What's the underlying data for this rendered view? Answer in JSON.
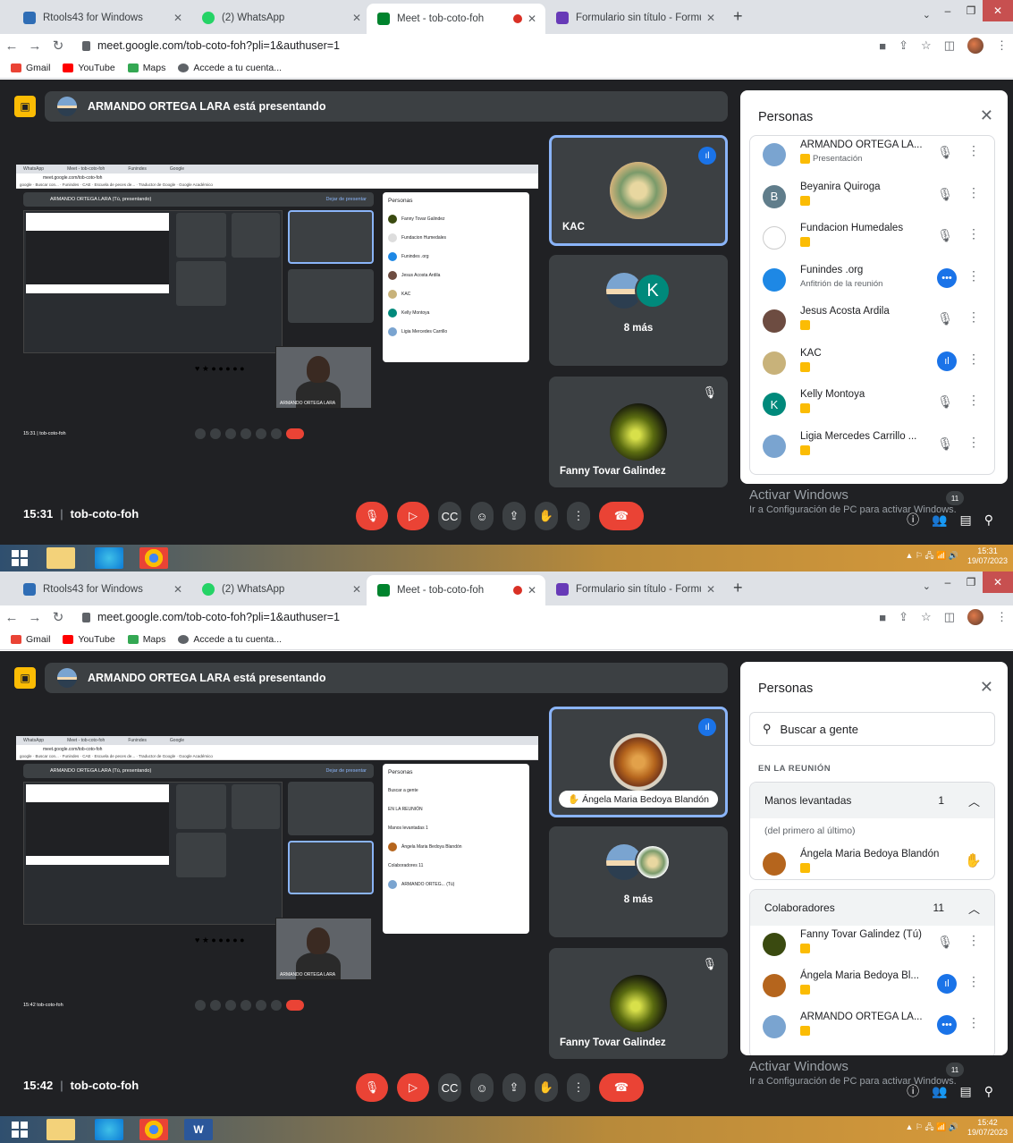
{
  "screens": [
    {
      "tabs": [
        {
          "label": "Rtools43 for Windows"
        },
        {
          "label": "(2) WhatsApp"
        },
        {
          "label": "Meet - tob-coto-foh"
        },
        {
          "label": "Formulario sin título - Formulario"
        }
      ],
      "url": "meet.google.com/tob-coto-foh?pli=1&authuser=1",
      "bookmarks": [
        "Gmail",
        "YouTube",
        "Maps",
        "Accede a tu cuenta..."
      ],
      "presenter_banner": "ARMANDO ORTEGA LARA está presentando",
      "tiles": [
        "KAC",
        "8 más",
        "Fanny Tovar Galindez"
      ],
      "time": "15:31",
      "meeting_code": "tob-coto-foh",
      "panel": {
        "title": "Personas",
        "people": [
          {
            "name": "ARMANDO ORTEGA LA...",
            "sub": "Presentación",
            "color": "#7aa4d0",
            "icon": "mic-off-icon"
          },
          {
            "name": "Beyanira Quiroga",
            "sub": "",
            "initial": "B",
            "color": "#607d8b",
            "icon": "mic-off-icon"
          },
          {
            "name": "Fundacion Humedales",
            "sub": "",
            "color": "#ffffff",
            "icon": "mic-off-icon"
          },
          {
            "name": "Funindes .org",
            "sub": "Anfitrión de la reunión",
            "color": "#1e88e5",
            "icon": "more-icon"
          },
          {
            "name": "Jesus Acosta Ardila",
            "sub": "",
            "color": "#6d4c41",
            "icon": "mic-off-icon"
          },
          {
            "name": "KAC",
            "sub": "",
            "color": "#c8b27a",
            "icon": "speaking-icon"
          },
          {
            "name": "Kelly Montoya",
            "sub": "",
            "initial": "K",
            "color": "#00897b",
            "icon": "mic-off-icon"
          },
          {
            "name": "Ligia Mercedes Carrillo ...",
            "sub": "",
            "color": "#7aa4d0",
            "icon": "mic-off-icon"
          }
        ]
      },
      "watermark": {
        "line1": "Activar Windows",
        "line2": "Ir a Configuración de PC para activar Windows."
      },
      "count_badge": "11",
      "taskbar_time": "15:31",
      "taskbar_date": "19/07/2023"
    },
    {
      "tabs": [
        {
          "label": "Rtools43 for Windows"
        },
        {
          "label": "(2) WhatsApp"
        },
        {
          "label": "Meet - tob-coto-foh"
        },
        {
          "label": "Formulario sin título - Formulario"
        }
      ],
      "url": "meet.google.com/tob-coto-foh?pli=1&authuser=1",
      "bookmarks": [
        "Gmail",
        "YouTube",
        "Maps",
        "Accede a tu cuenta..."
      ],
      "presenter_banner": "ARMANDO ORTEGA LARA está presentando",
      "hand_badge": "Ángela Maria Bedoya Blandón",
      "tiles": [
        "8 más",
        "Fanny Tovar Galindez"
      ],
      "time": "15:42",
      "meeting_code": "tob-coto-foh",
      "panel": {
        "title": "Personas",
        "search_placeholder": "Buscar a gente",
        "in_meeting": "EN LA REUNIÓN",
        "raised": {
          "label": "Manos levantadas",
          "count": "1",
          "note": "(del primero al último)",
          "person": "Ángela Maria Bedoya Blandón"
        },
        "collab": {
          "label": "Colaboradores",
          "count": "11"
        },
        "people": [
          {
            "name": "Fanny Tovar Galindez (Tú)",
            "color": "#3a4a10",
            "icon": "mic-off-icon"
          },
          {
            "name": "Ángela Maria Bedoya Bl...",
            "color": "#b5651d",
            "icon": "speaking-icon"
          },
          {
            "name": "ARMANDO ORTEGA LA...",
            "color": "#7aa4d0",
            "icon": "more-icon"
          }
        ]
      },
      "watermark": {
        "line1": "Activar Windows",
        "line2": "Ir a Configuración de PC para activar Windows."
      },
      "count_badge": "11",
      "taskbar_time": "15:42",
      "taskbar_date": "19/07/2023"
    }
  ]
}
